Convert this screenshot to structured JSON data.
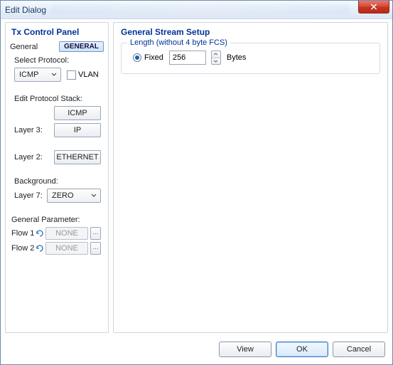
{
  "title": "Edit Dialog",
  "left": {
    "panel_title": "Tx Control Panel",
    "general_label": "General",
    "general_button": "GENERAL",
    "select_protocol_label": "Select Protocol:",
    "protocol_value": "ICMP",
    "vlan_label": "VLAN",
    "edit_stack_label": "Edit Protocol Stack:",
    "layer3_label": "Layer 3:",
    "icmp_button": "ICMP",
    "ip_button": "IP",
    "layer2_label": "Layer 2:",
    "ethernet_button": "ETHERNET",
    "background_label": "Background:",
    "layer7_label": "Layer 7:",
    "layer7_value": "ZERO",
    "general_param_label": "General Parameter:",
    "flow1_label": "Flow 1",
    "flow2_label": "Flow 2",
    "none_value": "NONE"
  },
  "right": {
    "panel_title": "General Stream Setup",
    "length_group": "Length (without 4 byte FCS)",
    "fixed_label": "Fixed",
    "length_value": "256",
    "bytes_label": "Bytes"
  },
  "footer": {
    "view": "View",
    "ok": "OK",
    "cancel": "Cancel"
  }
}
